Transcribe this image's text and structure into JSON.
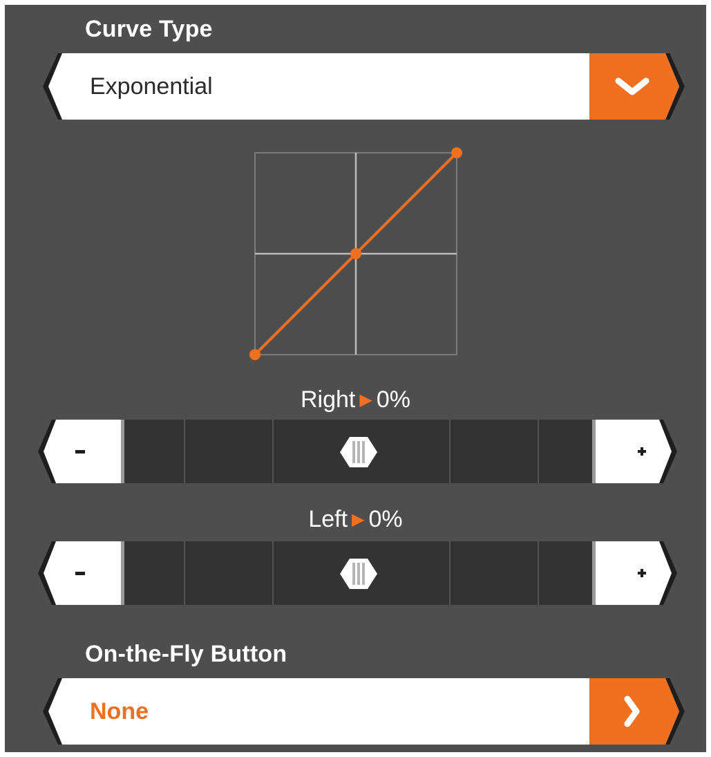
{
  "curve_type": {
    "label": "Curve Type",
    "selected": "Exponential",
    "action_icon": "chevron-down-icon"
  },
  "curve_graph": {
    "points": [
      {
        "x": -1,
        "y": -1
      },
      {
        "x": 0,
        "y": 0
      },
      {
        "x": 1,
        "y": 1
      }
    ],
    "x_range": [
      -1,
      1
    ],
    "y_range": [
      -1,
      1
    ],
    "line_color": "#f07020",
    "grid": true
  },
  "right": {
    "label": "Right",
    "arrow_icon": "triangle-right-icon",
    "value": "0%",
    "level": 0.5,
    "minus_symbol": "−",
    "plus_symbol": "+"
  },
  "left": {
    "label": "Left",
    "arrow_icon": "triangle-right-icon",
    "value": "0%",
    "level": 0.5,
    "minus_symbol": "−",
    "plus_symbol": "+"
  },
  "on_the_fly": {
    "label": "On-the-Fly Button",
    "selected": "None",
    "action_icon": "chevron-right-icon"
  },
  "colors": {
    "background": "#4e4e4e",
    "accent": "#f07020",
    "field": "#ffffff",
    "track": "#333333"
  }
}
